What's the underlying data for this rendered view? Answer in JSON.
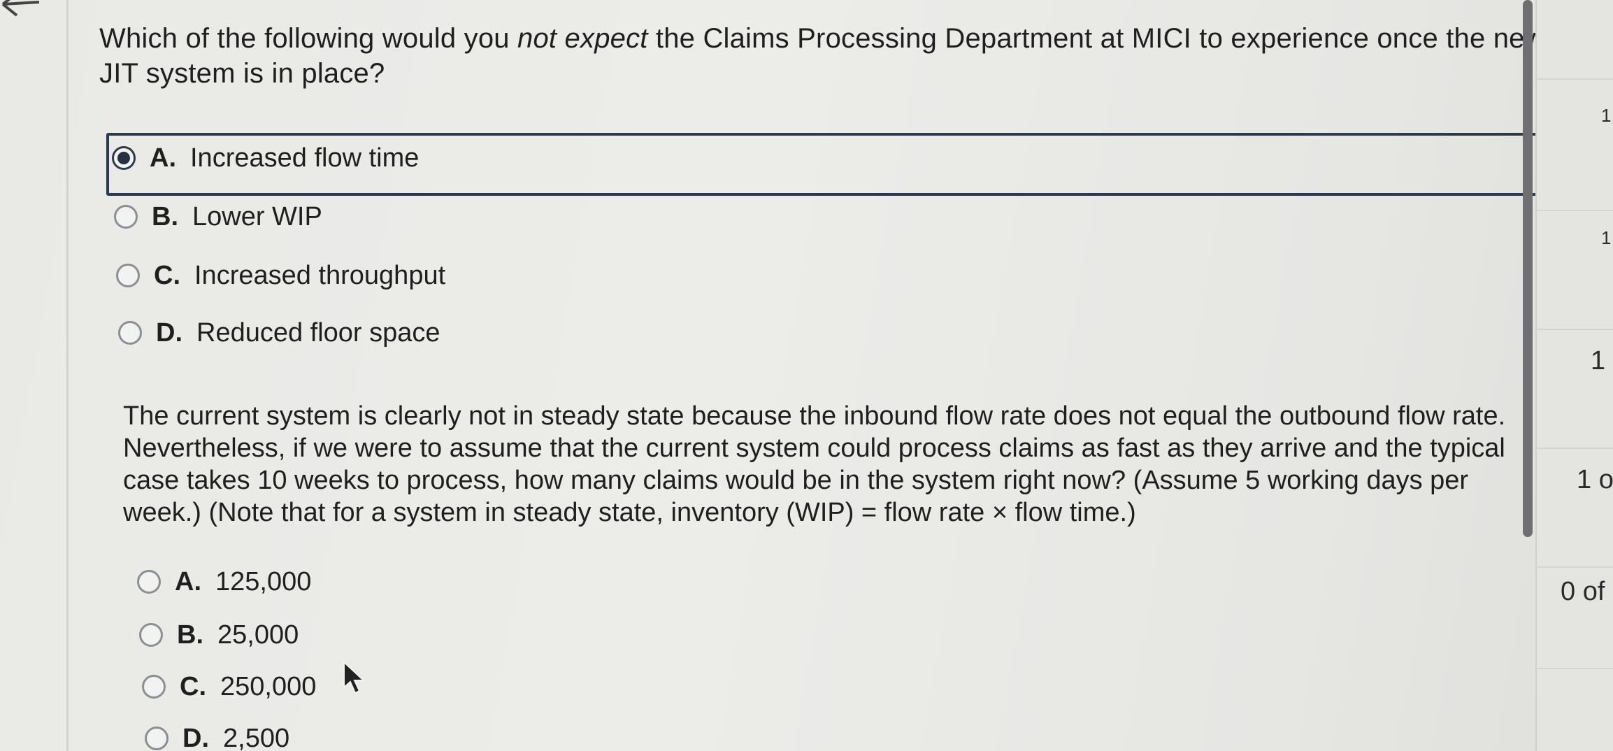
{
  "question1": {
    "text_before": "Which of the following would you ",
    "text_em": "not expect",
    "text_after": " the Claims Processing Department at MICI to experience once the new JIT system is in place?",
    "options": [
      {
        "letter": "A.",
        "label": "Increased flow time",
        "selected": true
      },
      {
        "letter": "B.",
        "label": "Lower WIP",
        "selected": false
      },
      {
        "letter": "C.",
        "label": "Increased throughput",
        "selected": false
      },
      {
        "letter": "D.",
        "label": "Reduced floor space",
        "selected": false
      }
    ]
  },
  "question2": {
    "text": "The current system is clearly not in steady state because the inbound flow rate does not equal the outbound flow rate. Nevertheless, if we were to assume that the current system could process claims as fast as they arrive and the typical case takes 10 weeks to process, how many claims would be in the system right now? (Assume 5 working days per week.) (Note that for a system in steady state, inventory (WIP) = flow rate × flow time.)",
    "options": [
      {
        "letter": "A.",
        "label": "125,000",
        "selected": false
      },
      {
        "letter": "B.",
        "label": "25,000",
        "selected": false
      },
      {
        "letter": "C.",
        "label": "250,000",
        "selected": false
      },
      {
        "letter": "D.",
        "label": "2,500",
        "selected": false
      }
    ]
  },
  "right_panel": {
    "fragment_1": "1",
    "fragment_2": "1",
    "fragment_3": "1",
    "fragment_4": "1 o",
    "fragment_5": "0 of"
  }
}
